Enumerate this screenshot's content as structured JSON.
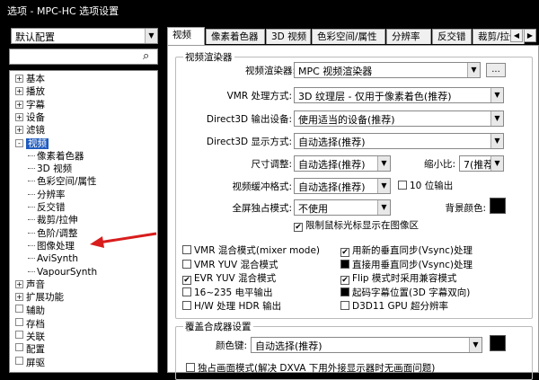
{
  "window": {
    "title": "选项 - MPC-HC 选项设置"
  },
  "left": {
    "profile": "默认配置",
    "tree": [
      {
        "label": "基本",
        "level": 0,
        "expander": "+"
      },
      {
        "label": "播放",
        "level": 0,
        "expander": "+"
      },
      {
        "label": "字幕",
        "level": 0,
        "expander": "+"
      },
      {
        "label": "设备",
        "level": 0,
        "expander": "+"
      },
      {
        "label": "滤镜",
        "level": 0,
        "expander": "+"
      },
      {
        "label": "视频",
        "level": 0,
        "expander": "-",
        "selected": true
      },
      {
        "label": "像素着色器",
        "level": 1
      },
      {
        "label": "3D 视频",
        "level": 1
      },
      {
        "label": "色彩空间/属性",
        "level": 1
      },
      {
        "label": "分辨率",
        "level": 1
      },
      {
        "label": "反交错",
        "level": 1
      },
      {
        "label": "裁剪/拉伸",
        "level": 1
      },
      {
        "label": "色阶/调整",
        "level": 1
      },
      {
        "label": "图像处理",
        "level": 1
      },
      {
        "label": "AviSynth",
        "level": 1
      },
      {
        "label": "VapourSynth",
        "level": 1
      },
      {
        "label": "声音",
        "level": 0,
        "expander": "+"
      },
      {
        "label": "扩展功能",
        "level": 0,
        "expander": "+"
      },
      {
        "label": "辅助",
        "level": 0,
        "expander": ""
      },
      {
        "label": "存档",
        "level": 0,
        "expander": ""
      },
      {
        "label": "关联",
        "level": 0,
        "expander": ""
      },
      {
        "label": "配置",
        "level": 0,
        "expander": ""
      },
      {
        "label": "屏驱",
        "level": 0,
        "expander": ""
      }
    ]
  },
  "tabs": [
    "视频",
    "像素着色器",
    "3D 视频",
    "色彩空间/属性",
    "分辨率",
    "反交错",
    "裁剪/拉伸"
  ],
  "renderer_group": {
    "title": "视频渲染器",
    "renderer_label": "视频渲染器:",
    "renderer_value": "MPC 视频渲染器",
    "more_button": "...",
    "vmr_label": "VMR 处理方式:",
    "vmr_value": "3D 纹理层 - 仅用于像素着色(推荐)",
    "d3d_output_label": "Direct3D 输出设备:",
    "d3d_output_value": "使用适当的设备(推荐)",
    "d3d_mode_label": "Direct3D 显示方式:",
    "d3d_mode_value": "自动选择(推荐)",
    "resize_label": "尺寸调整:",
    "resize_value": "自动选择(推荐)",
    "scale_label": "缩小比:",
    "scale_value": "7(推荐)",
    "buffer_label": "视频缓冲格式:",
    "buffer_value": "自动选择(推荐)",
    "tenbit_label": "10 位输出",
    "fullscreen_label": "全屏独占模式:",
    "fullscreen_value": "不使用",
    "bgcolor_label": "背景颜色:",
    "cursor_limit_label": "限制鼠标光标显示在图像区"
  },
  "checks_left": [
    {
      "label": "VMR 混合模式(mixer mode)",
      "state": "off"
    },
    {
      "label": "VMR YUV 混合模式",
      "state": "off"
    },
    {
      "label": "EVR YUV 混合模式",
      "state": "on"
    },
    {
      "label": "16~235 电平输出",
      "state": "off"
    },
    {
      "label": "H/W 处理 HDR 输出",
      "state": "off"
    }
  ],
  "checks_right": [
    {
      "label": "用新的垂直同步(Vsync)处理",
      "state": "on"
    },
    {
      "label": "直接用垂直同步(Vsync)处理",
      "state": "fill"
    },
    {
      "label": "Flip 模式时采用兼容模式",
      "state": "on"
    },
    {
      "label": "起码字幕位置(3D 字幕双向)",
      "state": "fill"
    },
    {
      "label": "D3D11 GPU 超分辨率",
      "state": "off"
    }
  ],
  "overlay_group": {
    "title": "覆盖合成器设置",
    "color_label": "颜色键:",
    "color_value": "自动选择(推荐)",
    "exclusive_label": "独占画面模式(解决 DXVA 下用外接显示器时无画面问题)"
  }
}
